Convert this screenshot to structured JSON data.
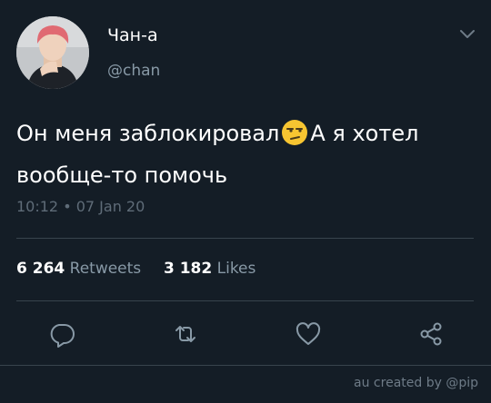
{
  "tweet": {
    "display_name": "Чан-а",
    "handle": "@chan",
    "text_part1": "Он меня заблокировал",
    "text_part2": "А я хотел вообще-то помочь",
    "timestamp": "10:12 • 07 Jan 20",
    "retweets_count": "6 264",
    "retweets_label": "Retweets",
    "likes_count": "3 182",
    "likes_label": "Likes"
  },
  "icons": {
    "caret": "chevron-down-icon",
    "emoji": "unamused-face-emoji",
    "reply": "reply-icon",
    "retweet": "retweet-icon",
    "like": "heart-icon",
    "share": "share-icon"
  },
  "footer": {
    "credit": "au created by @pip"
  },
  "colors": {
    "background": "#141d26",
    "text": "#ffffff",
    "secondary": "#8899a6",
    "divider": "#38444d"
  }
}
